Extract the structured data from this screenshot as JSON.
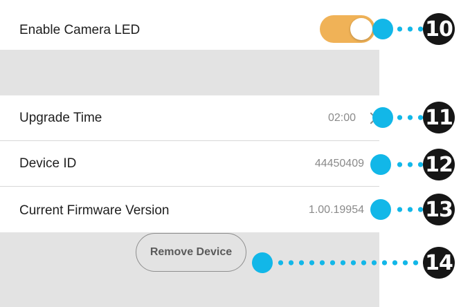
{
  "settings": {
    "camera_led": {
      "label": "Enable Camera LED",
      "enabled": true
    },
    "upgrade_time": {
      "label": "Upgrade Time",
      "value": "02:00"
    },
    "device_id": {
      "label": "Device ID",
      "value": "44450409"
    },
    "firmware": {
      "label": "Current Firmware Version",
      "value": "1.00.19954"
    }
  },
  "actions": {
    "remove_device": "Remove Device"
  },
  "callouts": [
    "10",
    "11",
    "12",
    "13",
    "14"
  ],
  "colors": {
    "toggle_on": "#f0b257",
    "callout_dot": "#12b7e8",
    "badge": "#161616",
    "section_gray": "#e3e3e3"
  }
}
